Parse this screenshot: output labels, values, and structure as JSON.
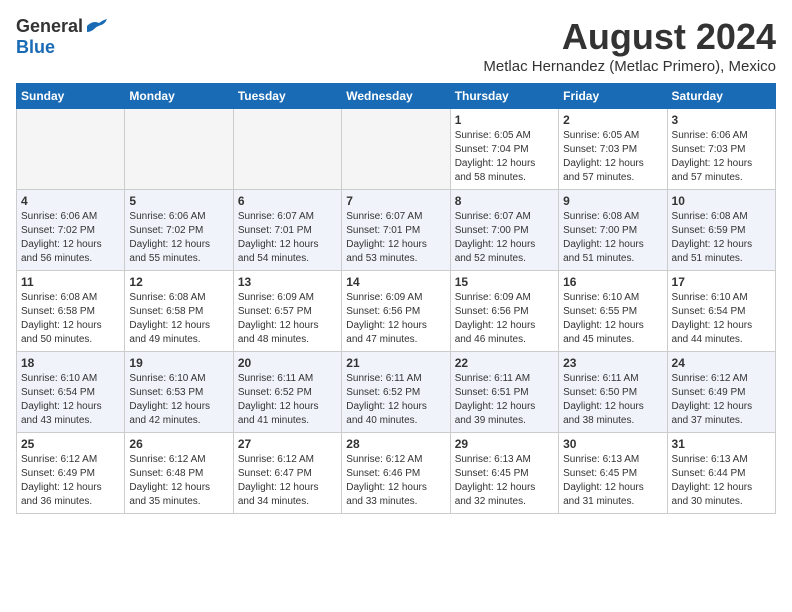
{
  "header": {
    "logo_line1": "General",
    "logo_line2": "Blue",
    "main_title": "August 2024",
    "subtitle": "Metlac Hernandez (Metlac Primero), Mexico"
  },
  "calendar": {
    "days_of_week": [
      "Sunday",
      "Monday",
      "Tuesday",
      "Wednesday",
      "Thursday",
      "Friday",
      "Saturday"
    ],
    "weeks": [
      [
        {
          "day": "",
          "empty": true
        },
        {
          "day": "",
          "empty": true
        },
        {
          "day": "",
          "empty": true
        },
        {
          "day": "",
          "empty": true
        },
        {
          "day": "1",
          "sunrise": "6:05 AM",
          "sunset": "7:04 PM",
          "daylight": "12 hours and 58 minutes."
        },
        {
          "day": "2",
          "sunrise": "6:05 AM",
          "sunset": "7:03 PM",
          "daylight": "12 hours and 57 minutes."
        },
        {
          "day": "3",
          "sunrise": "6:06 AM",
          "sunset": "7:03 PM",
          "daylight": "12 hours and 57 minutes."
        }
      ],
      [
        {
          "day": "4",
          "sunrise": "6:06 AM",
          "sunset": "7:02 PM",
          "daylight": "12 hours and 56 minutes."
        },
        {
          "day": "5",
          "sunrise": "6:06 AM",
          "sunset": "7:02 PM",
          "daylight": "12 hours and 55 minutes."
        },
        {
          "day": "6",
          "sunrise": "6:07 AM",
          "sunset": "7:01 PM",
          "daylight": "12 hours and 54 minutes."
        },
        {
          "day": "7",
          "sunrise": "6:07 AM",
          "sunset": "7:01 PM",
          "daylight": "12 hours and 53 minutes."
        },
        {
          "day": "8",
          "sunrise": "6:07 AM",
          "sunset": "7:00 PM",
          "daylight": "12 hours and 52 minutes."
        },
        {
          "day": "9",
          "sunrise": "6:08 AM",
          "sunset": "7:00 PM",
          "daylight": "12 hours and 51 minutes."
        },
        {
          "day": "10",
          "sunrise": "6:08 AM",
          "sunset": "6:59 PM",
          "daylight": "12 hours and 51 minutes."
        }
      ],
      [
        {
          "day": "11",
          "sunrise": "6:08 AM",
          "sunset": "6:58 PM",
          "daylight": "12 hours and 50 minutes."
        },
        {
          "day": "12",
          "sunrise": "6:08 AM",
          "sunset": "6:58 PM",
          "daylight": "12 hours and 49 minutes."
        },
        {
          "day": "13",
          "sunrise": "6:09 AM",
          "sunset": "6:57 PM",
          "daylight": "12 hours and 48 minutes."
        },
        {
          "day": "14",
          "sunrise": "6:09 AM",
          "sunset": "6:56 PM",
          "daylight": "12 hours and 47 minutes."
        },
        {
          "day": "15",
          "sunrise": "6:09 AM",
          "sunset": "6:56 PM",
          "daylight": "12 hours and 46 minutes."
        },
        {
          "day": "16",
          "sunrise": "6:10 AM",
          "sunset": "6:55 PM",
          "daylight": "12 hours and 45 minutes."
        },
        {
          "day": "17",
          "sunrise": "6:10 AM",
          "sunset": "6:54 PM",
          "daylight": "12 hours and 44 minutes."
        }
      ],
      [
        {
          "day": "18",
          "sunrise": "6:10 AM",
          "sunset": "6:54 PM",
          "daylight": "12 hours and 43 minutes."
        },
        {
          "day": "19",
          "sunrise": "6:10 AM",
          "sunset": "6:53 PM",
          "daylight": "12 hours and 42 minutes."
        },
        {
          "day": "20",
          "sunrise": "6:11 AM",
          "sunset": "6:52 PM",
          "daylight": "12 hours and 41 minutes."
        },
        {
          "day": "21",
          "sunrise": "6:11 AM",
          "sunset": "6:52 PM",
          "daylight": "12 hours and 40 minutes."
        },
        {
          "day": "22",
          "sunrise": "6:11 AM",
          "sunset": "6:51 PM",
          "daylight": "12 hours and 39 minutes."
        },
        {
          "day": "23",
          "sunrise": "6:11 AM",
          "sunset": "6:50 PM",
          "daylight": "12 hours and 38 minutes."
        },
        {
          "day": "24",
          "sunrise": "6:12 AM",
          "sunset": "6:49 PM",
          "daylight": "12 hours and 37 minutes."
        }
      ],
      [
        {
          "day": "25",
          "sunrise": "6:12 AM",
          "sunset": "6:49 PM",
          "daylight": "12 hours and 36 minutes."
        },
        {
          "day": "26",
          "sunrise": "6:12 AM",
          "sunset": "6:48 PM",
          "daylight": "12 hours and 35 minutes."
        },
        {
          "day": "27",
          "sunrise": "6:12 AM",
          "sunset": "6:47 PM",
          "daylight": "12 hours and 34 minutes."
        },
        {
          "day": "28",
          "sunrise": "6:12 AM",
          "sunset": "6:46 PM",
          "daylight": "12 hours and 33 minutes."
        },
        {
          "day": "29",
          "sunrise": "6:13 AM",
          "sunset": "6:45 PM",
          "daylight": "12 hours and 32 minutes."
        },
        {
          "day": "30",
          "sunrise": "6:13 AM",
          "sunset": "6:45 PM",
          "daylight": "12 hours and 31 minutes."
        },
        {
          "day": "31",
          "sunrise": "6:13 AM",
          "sunset": "6:44 PM",
          "daylight": "12 hours and 30 minutes."
        }
      ]
    ]
  }
}
